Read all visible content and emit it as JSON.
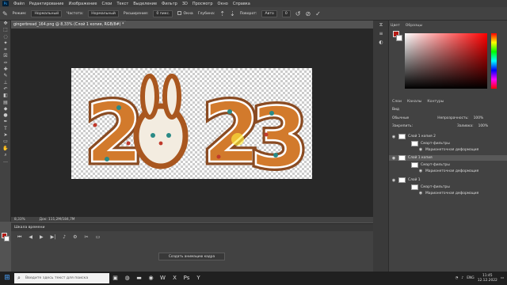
{
  "menu": [
    "Файл",
    "Редактирование",
    "Изображение",
    "Слои",
    "Текст",
    "Выделение",
    "Фильтр",
    "3D",
    "Просмотр",
    "Окно",
    "Справка"
  ],
  "options": {
    "mode_label": "Режим:",
    "mode_value": "Нормальный",
    "opacity_label": "Частота:",
    "opacity_value": "Нормальный",
    "spacing_label": "Расширение:",
    "spacing_value": "0 пикс.",
    "aa_label": "Окна",
    "depth_label": "Глубина:",
    "depth_value": "",
    "rotate_label": "Поворот:",
    "rotate_value": "Авто",
    "angle": "0"
  },
  "document": {
    "tab": "gingerbread_164.png @ 8,33% (Слой 1 копия, RGB/8#) *",
    "zoom": "8,33%",
    "doc_info": "Док: 111,2M/184,7M"
  },
  "canvas_text": "2023",
  "timeline": {
    "tab": "Шкала времени",
    "create_btn": "Создать анимацию кадра"
  },
  "panels": {
    "color_tab": "Цвет",
    "swatches_tab": "Образцы",
    "layers_tab": "Слои",
    "channels_tab": "Каналы",
    "paths_tab": "Контуры"
  },
  "layers_panel": {
    "kind": "Вид",
    "blend": "Обычные",
    "opacity_label": "Непрозрачность:",
    "opacity": "100%",
    "lock_label": "Закрепить:",
    "fill_label": "Заливка:",
    "fill": "100%"
  },
  "layers": [
    {
      "name": "Слой 1 копия 2",
      "sub1": "Смарт-фильтры",
      "sub2": "Марионеточная деформация"
    },
    {
      "name": "Слой 1 копия",
      "sub1": "Смарт-фильтры",
      "sub2": "Марионеточная деформация"
    },
    {
      "name": "Слой 1",
      "sub1": "Смарт-фильтры",
      "sub2": "Марионеточная деформация"
    }
  ],
  "taskbar": {
    "search_placeholder": "Введите здесь текст для поиска",
    "lang": "ENG",
    "time": "11:45",
    "date": "12.12.2022"
  },
  "colors": {
    "foreground": "#b51a14",
    "background": "#ffffff",
    "accent": "#31a8ff"
  }
}
